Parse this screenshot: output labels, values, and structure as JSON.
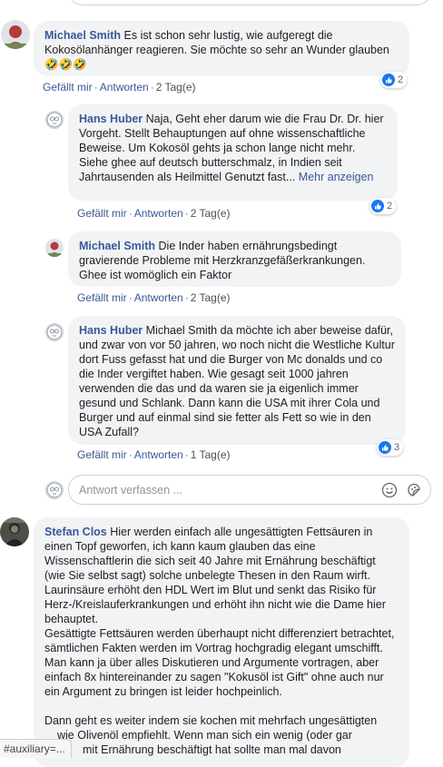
{
  "comments": [
    {
      "author": "Michael Smith",
      "text": "Es ist schon sehr lustig, wie aufgeregt die Kokosölanhänger reagieren. Sie möchte so sehr an Wunder glauben 🤣🤣🤣",
      "like_label": "Gefällt mir",
      "reply_label": "Antworten",
      "time": "2 Tag(e)",
      "reaction_count": "2"
    },
    {
      "author": "Hans Huber",
      "text": "Naja, Geht eher darum wie die Frau Dr. Dr. hier Vorgeht. Stellt Behauptungen auf ohne wissenschaftliche Beweise. Um Kokosöl gehts ja schon lange nicht mehr. Siehe ghee auf deutsch butterschmalz, in Indien seit Jahrtausenden als Heilmittel Genutzt fast...",
      "more": "Mehr anzeigen",
      "like_label": "Gefällt mir",
      "reply_label": "Antworten",
      "time": "2 Tag(e)",
      "reaction_count": "2"
    },
    {
      "author": "Michael Smith",
      "text": "Die Inder haben ernährungsbedingt gravierende Probleme mit Herzkranzgefäßerkrankungen. Ghee ist womöglich ein Faktor",
      "like_label": "Gefällt mir",
      "reply_label": "Antworten",
      "time": "2 Tag(e)"
    },
    {
      "author": "Hans Huber",
      "text": "Michael Smith da möchte ich aber beweise dafür, und zwar von vor 50 jahren, wo noch nicht die Westliche Kultur dort Fuss gefasst hat und die Burger von Mc donalds und co die Inder vergiftet haben. Wie gesagt seit 1000 jahren verwenden die das und da waren sie ja eigenlich immer gesund und Schlank. Dann kann die USA mit ihrer Cola und Burger und auf einmal sind sie fetter als Fett so wie in den USA Zufall?",
      "like_label": "Gefällt mir",
      "reply_label": "Antworten",
      "time": "1 Tag(e)",
      "reaction_count": "3"
    }
  ],
  "reply_placeholder": "Antwort verfassen ...",
  "stefan": {
    "author": "Stefan Clos",
    "p1": "Hier werden einfach alle ungesättigten Fettsäuren in einen Topf geworfen, ich kann kaum glauben das eine Wissenschaftlerin die sich seit 40 Jahre mit Ernährung beschäftigt (wie Sie selbst sagt) solche unbelegte Thesen in den Raum wirft.",
    "p2": "Laurinsäure erhöht den HDL Wert im Blut und senkt das Risiko für Herz-/Kreislauferkrankungen und erhöht ihn nicht wie die Dame hier behauptet.",
    "p3": "Gesättigte Fettsäuren werden überhaupt nicht differenziert betrachtet, sämtlichen Fakten werden im Vortrag hochgradig elegant umschifft.",
    "p4": "Man kann ja über alles Diskutieren und Argumente vortragen, aber einfach 8x hintereinander zu sagen \"Kokusöl ist Gift\" ohne auch nur ein Argument zu bringen ist leider hochpeinlich.",
    "p5a": "Dann geht es weiter indem sie kochen mit mehrfach ungesättigten",
    "p5b": "wie Olivenöl empfiehlt. Wenn man sich ein wenig (oder gar",
    "p5c": "mit Ernährung beschäftigt hat sollte man mal davon"
  },
  "status_text": "#auxiliary=...",
  "icons": [
    "like-icon",
    "emoji-icon",
    "sticker-icon"
  ],
  "colors": {
    "link": "#385898",
    "bubble": "#f2f3f5",
    "like": "#1877f2"
  }
}
